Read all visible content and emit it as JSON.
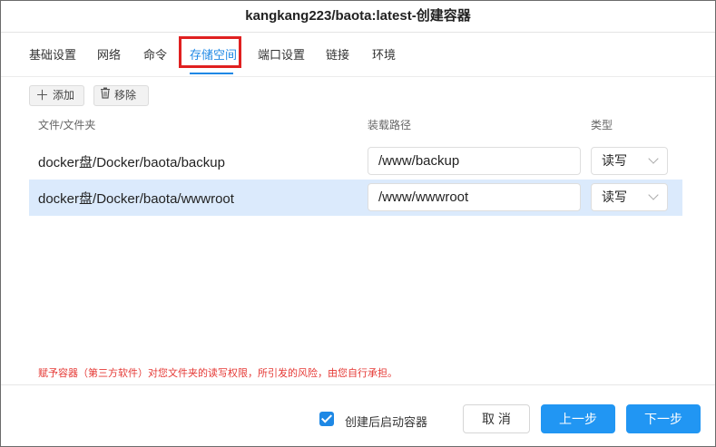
{
  "window": {
    "title": "kangkang223/baota:latest-创建容器"
  },
  "tabs": [
    {
      "label": "基础设置"
    },
    {
      "label": "网络"
    },
    {
      "label": "命令"
    },
    {
      "label": "存储空间",
      "active": true
    },
    {
      "label": "端口设置"
    },
    {
      "label": "链接"
    },
    {
      "label": "环境"
    }
  ],
  "toolbar": {
    "add_label": "添加",
    "remove_label": "移除"
  },
  "table": {
    "headers": {
      "folder": "文件/文件夹",
      "mount_path": "装载路径",
      "type": "类型"
    },
    "rows": [
      {
        "folder": "docker盘/Docker/baota/backup",
        "mount_path": "/www/backup",
        "type": "读写",
        "selected": false
      },
      {
        "folder": "docker盘/Docker/baota/wwwroot",
        "mount_path": "/www/wwwroot",
        "type": "读写",
        "selected": true
      }
    ]
  },
  "warning": "赋予容器（第三方软件）对您文件夹的读写权限，所引发的风险，由您自行承担。",
  "footer": {
    "autostart_label": "创建后启动容器",
    "autostart_checked": true,
    "cancel_label": "取 消",
    "prev_label": "上一步",
    "next_label": "下一步"
  },
  "colors": {
    "accent": "#1e88e5",
    "highlight_box": "#e02020",
    "warning": "#e53935",
    "selected_row": "#dbeafc"
  },
  "icons": {
    "add": "plus-icon",
    "remove": "trash-icon",
    "dropdown": "chevron-down-icon",
    "checkbox": "checkmark-icon"
  }
}
